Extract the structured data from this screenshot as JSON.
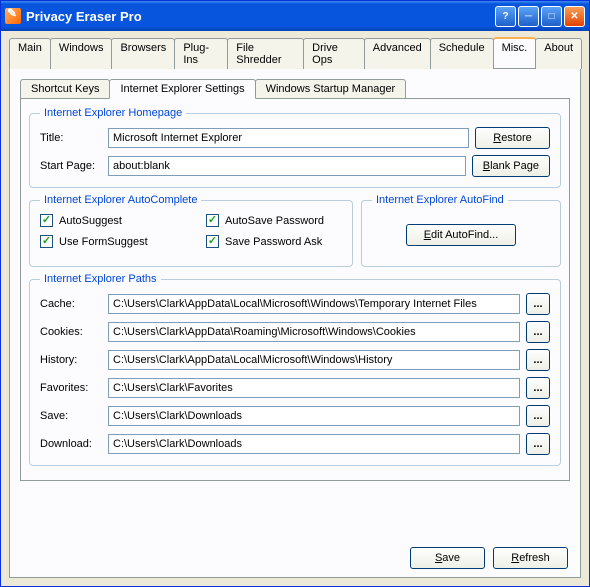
{
  "title": "Privacy Eraser Pro",
  "mainTabs": [
    "Main",
    "Windows",
    "Browsers",
    "Plug-Ins",
    "File Shredder",
    "Drive Ops",
    "Advanced",
    "Schedule",
    "Misc.",
    "About"
  ],
  "activeMainTab": "Misc.",
  "subTabs": [
    "Shortcut Keys",
    "Internet Explorer Settings",
    "Windows Startup Manager"
  ],
  "activeSubTab": "Internet Explorer Settings",
  "homepage": {
    "legend": "Internet Explorer Homepage",
    "titleLabel": "Title:",
    "titleValue": "Microsoft Internet Explorer",
    "startLabel": "Start Page:",
    "startValue": "about:blank",
    "restore": "Restore",
    "blank": "Blank Page"
  },
  "autocomplete": {
    "legend": "Internet Explorer AutoComplete",
    "autoSuggest": "AutoSuggest",
    "useFormSuggest": "Use FormSuggest",
    "autoSavePassword": "AutoSave Password",
    "savePasswordAsk": "Save Password Ask"
  },
  "autofind": {
    "legend": "Internet Explorer AutoFind",
    "button": "Edit AutoFind..."
  },
  "paths": {
    "legend": "Internet Explorer Paths",
    "labels": {
      "cache": "Cache:",
      "cookies": "Cookies:",
      "history": "History:",
      "favorites": "Favorites:",
      "save": "Save:",
      "download": "Download:"
    },
    "values": {
      "cache": "C:\\Users\\Clark\\AppData\\Local\\Microsoft\\Windows\\Temporary Internet Files",
      "cookies": "C:\\Users\\Clark\\AppData\\Roaming\\Microsoft\\Windows\\Cookies",
      "history": "C:\\Users\\Clark\\AppData\\Local\\Microsoft\\Windows\\History",
      "favorites": "C:\\Users\\Clark\\Favorites",
      "save": "C:\\Users\\Clark\\Downloads",
      "download": "C:\\Users\\Clark\\Downloads"
    },
    "browse": "..."
  },
  "bottom": {
    "save": "Save",
    "refresh": "Refresh"
  }
}
